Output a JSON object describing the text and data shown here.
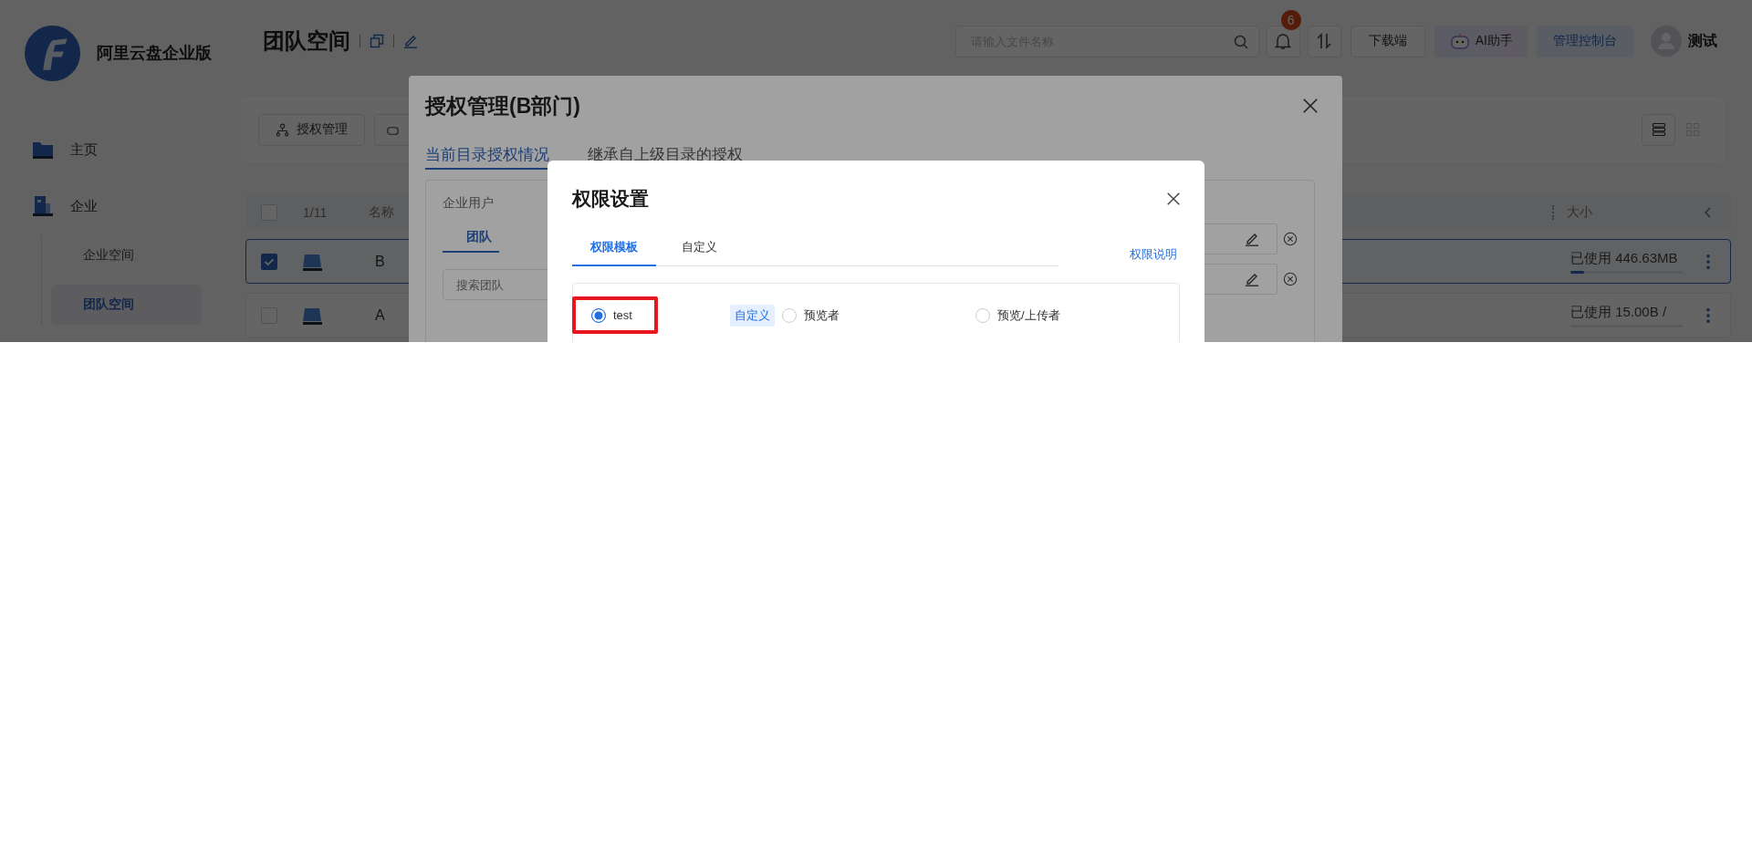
{
  "sidebar": {
    "brand": "阿里云盘企业版",
    "items": [
      {
        "label": "主页",
        "selected": false
      },
      {
        "label": "企业",
        "selected": false,
        "children": [
          {
            "label": "企业空间",
            "selected": false
          },
          {
            "label": "团队空间",
            "selected": true
          }
        ]
      }
    ]
  },
  "header": {
    "title": "团队空间",
    "search": {
      "placeholder": "请输入文件名称"
    },
    "notification_count": "6",
    "download_button": "下载端",
    "ai_button": "AI助手",
    "admin_button": "管理控制台",
    "user_name": "测试"
  },
  "toolbar": {
    "auth_button": "授权管理",
    "views": [
      {
        "kind": "list",
        "selected": true
      },
      {
        "kind": "grid",
        "selected": false
      }
    ]
  },
  "table": {
    "select_all_checked": false,
    "selection_count": "1/11",
    "columns": [
      "名称",
      "大小"
    ],
    "rows": [
      {
        "name": "B",
        "selected": true,
        "usage": "已使用 446.63MB",
        "level": 0.12
      },
      {
        "name": "A",
        "selected": false,
        "usage": "已使用 15.00B /",
        "level": 0
      }
    ]
  },
  "auth_dialog": {
    "title": "授权管理(B部门)",
    "tabs": [
      {
        "label": "当前目录授权情况",
        "selected": true
      },
      {
        "label": "继承自上级目录的授权",
        "selected": false
      }
    ],
    "panel": {
      "title": "企业用户",
      "tabs": [
        {
          "label": "团队",
          "selected": true
        }
      ],
      "search": {
        "placeholder": "搜索团队"
      }
    }
  },
  "permission_dialog": {
    "title": "权限设置",
    "tabs": [
      {
        "label": "权限模板",
        "selected": true
      },
      {
        "label": "自定义",
        "selected": false
      }
    ],
    "help_link": "权限说明",
    "options": [
      {
        "label": "test",
        "selected": true,
        "highlighted": true,
        "tag": "自定义"
      },
      {
        "label": "预览者",
        "selected": false,
        "highlighted": false
      },
      {
        "label": "预览/上传者",
        "selected": false,
        "highlighted": false
      }
    ]
  }
}
